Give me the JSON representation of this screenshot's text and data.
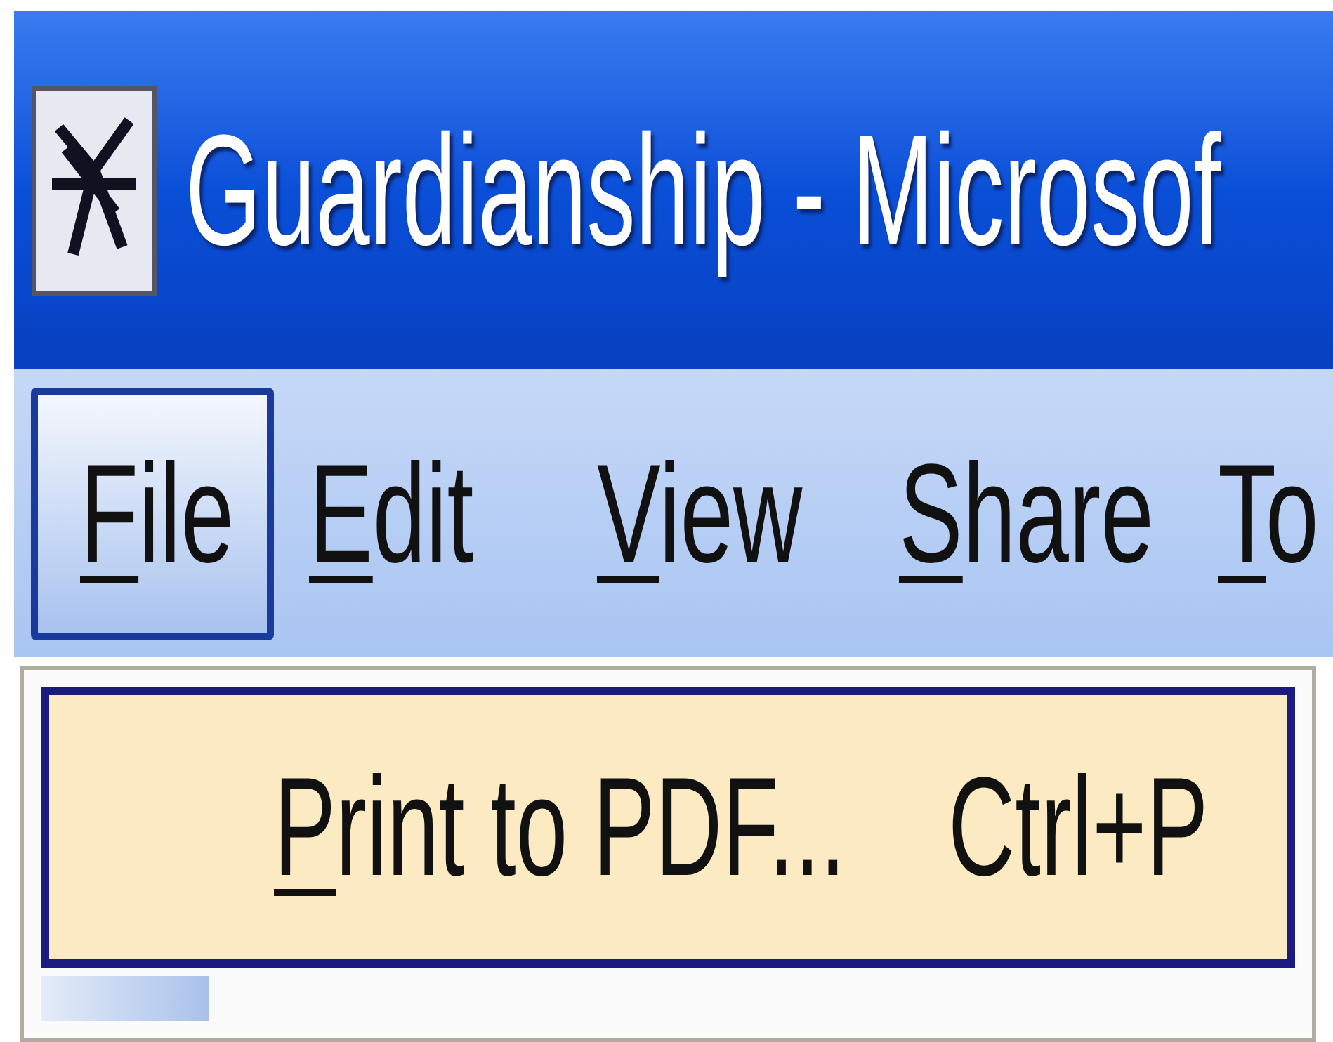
{
  "window": {
    "title": "Guardianship - Microsof"
  },
  "menu_bar": [
    {
      "label": "File",
      "selected": true
    },
    {
      "label": "Edit",
      "selected": false
    },
    {
      "label": "View",
      "selected": false
    },
    {
      "label": "Share",
      "selected": false
    },
    {
      "label": "To",
      "selected": false
    }
  ],
  "file_menu": [
    {
      "label": "Print to PDF...",
      "shortcut": "Ctrl+P",
      "selected": true
    }
  ]
}
